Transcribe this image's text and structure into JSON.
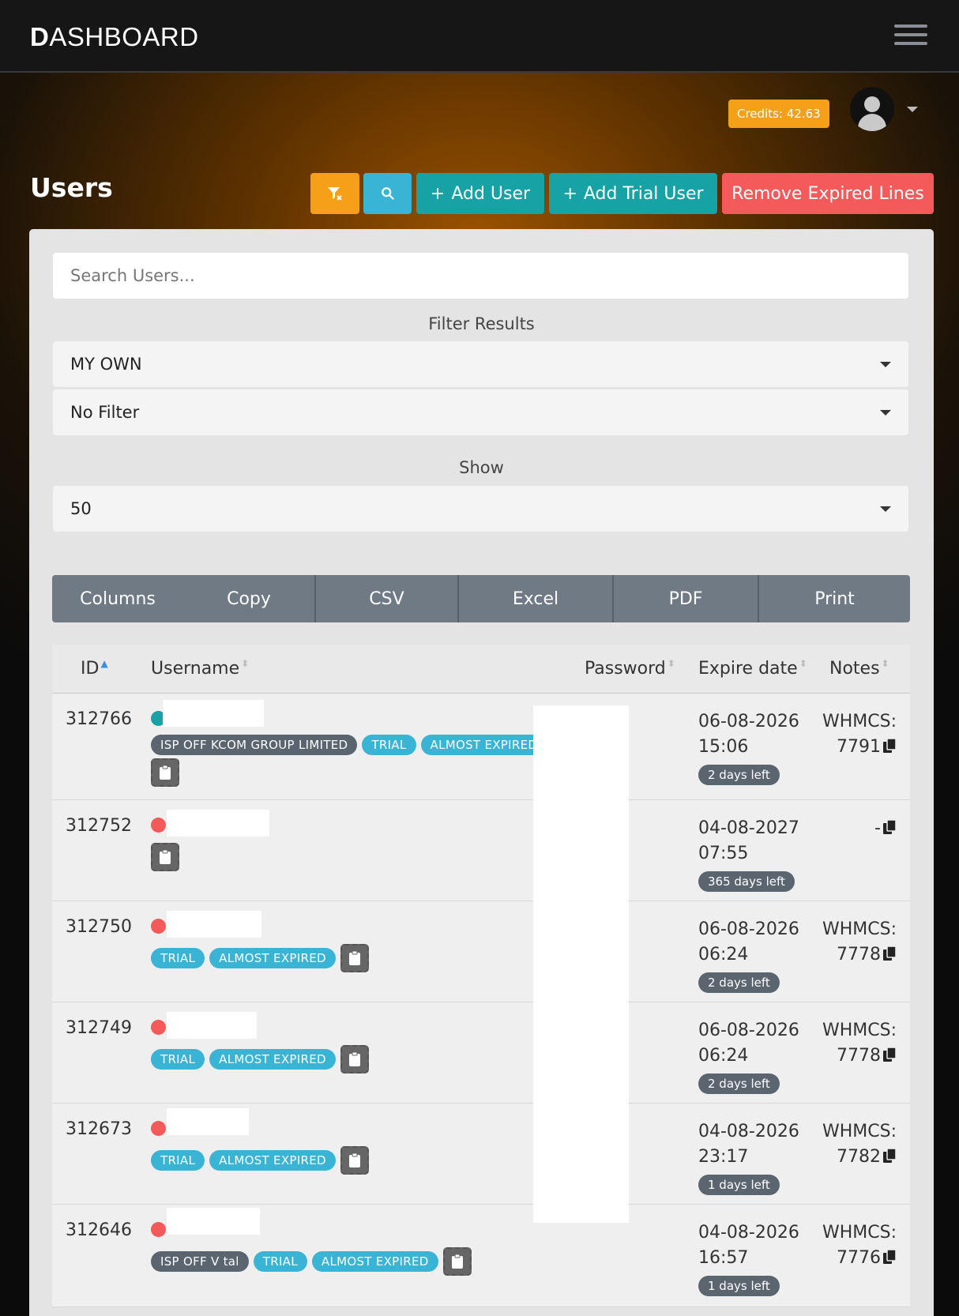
{
  "header": {
    "brand_first": "D",
    "brand_rest": "ASHBOARD",
    "credits": "Credits: 42.63"
  },
  "page": {
    "title": "Users"
  },
  "toolbar": {
    "add_user": "Add User",
    "add_trial": "Add Trial User",
    "remove_expired": "Remove Expired Lines",
    "plus": "+"
  },
  "search": {
    "placeholder": "Search Users..."
  },
  "filters": {
    "label": "Filter Results",
    "owner": "MY OWN",
    "filter": "No Filter",
    "show_label": "Show",
    "show_value": "50"
  },
  "export": {
    "columns": "Columns",
    "copy": "Copy",
    "csv": "CSV",
    "excel": "Excel",
    "pdf": "PDF",
    "print": "Print"
  },
  "table": {
    "headers": {
      "id": "ID",
      "username": "Username",
      "password": "Password",
      "expire": "Expire date",
      "notes": "Notes"
    },
    "rows": [
      {
        "id": "312766",
        "status": "green",
        "badges": [
          "ISP OFF KCOM GROUP LIMITED",
          "TRIAL",
          "ALMOST EXPIRED"
        ],
        "date": "06-08-2026",
        "time": "15:06",
        "days": "2 days left",
        "notes1": "WHMCS:",
        "notes2": "7791"
      },
      {
        "id": "312752",
        "status": "red",
        "badges": [],
        "date": "04-08-2027",
        "time": "07:55",
        "days": "365 days left",
        "notes1": "",
        "notes2": "-"
      },
      {
        "id": "312750",
        "status": "red",
        "badges": [
          "TRIAL",
          "ALMOST EXPIRED"
        ],
        "date": "06-08-2026",
        "time": "06:24",
        "days": "2 days left",
        "notes1": "WHMCS:",
        "notes2": "7778"
      },
      {
        "id": "312749",
        "status": "red",
        "badges": [
          "TRIAL",
          "ALMOST EXPIRED"
        ],
        "date": "06-08-2026",
        "time": "06:24",
        "days": "2 days left",
        "notes1": "WHMCS:",
        "notes2": "7778"
      },
      {
        "id": "312673",
        "status": "red",
        "badges": [
          "TRIAL",
          "ALMOST EXPIRED"
        ],
        "date": "04-08-2026",
        "time": "23:17",
        "days": "1 days left",
        "notes1": "WHMCS:",
        "notes2": "7782"
      },
      {
        "id": "312646",
        "status": "red",
        "badges": [
          "ISP OFF V tal",
          "TRIAL",
          "ALMOST EXPIRED"
        ],
        "date": "04-08-2026",
        "time": "16:57",
        "days": "1 days left",
        "notes1": "WHMCS:",
        "notes2": "7776"
      }
    ]
  },
  "colors": {
    "orange": "#f6a01a",
    "teal": "#17a2a6",
    "cyan": "#3ab4d4",
    "red": "#f55a5a",
    "slate": "#5b6570"
  }
}
